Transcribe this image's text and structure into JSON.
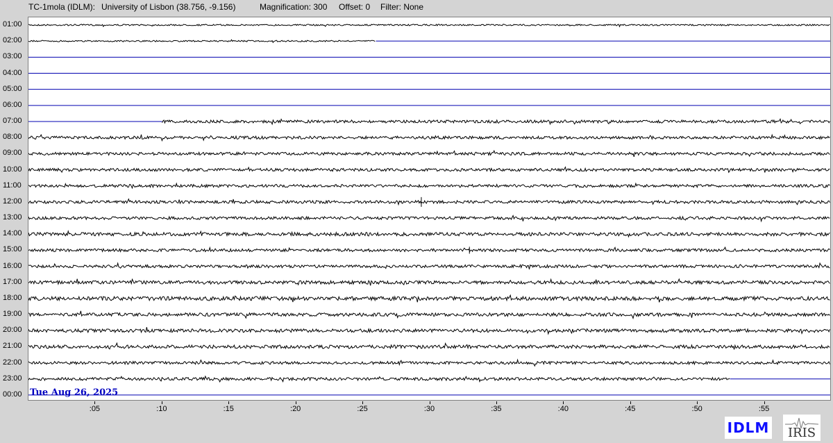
{
  "header": {
    "station": "TC-1mola (IDLM):",
    "location": "University of Lisbon (38.756, -9.156)",
    "magnification": "Magnification: 300",
    "offset": "Offset: 0",
    "filter": "Filter: None"
  },
  "hours": [
    "01:00",
    "02:00",
    "03:00",
    "04:00",
    "05:00",
    "06:00",
    "07:00",
    "08:00",
    "09:00",
    "10:00",
    "11:00",
    "12:00",
    "13:00",
    "14:00",
    "15:00",
    "16:00",
    "17:00",
    "18:00",
    "19:00",
    "20:00",
    "21:00",
    "22:00",
    "23:00",
    "00:00"
  ],
  "minute_ticks": [
    ":05",
    ":10",
    ":15",
    ":20",
    ":25",
    ":30",
    ":35",
    ":40",
    ":45",
    ":50",
    ":55"
  ],
  "date": "Tue Aug 26, 2025",
  "logos": {
    "idlm": "IDLM",
    "iris": "IRIS"
  },
  "colors": {
    "trace": "#000000",
    "baseline": "#0000b0",
    "date": "#0000c0",
    "logo_idlm": "#1010ff"
  },
  "traces": [
    {
      "hour": "01:00",
      "signal_start_min": 0,
      "signal_end_min": 60,
      "amp": 0.3
    },
    {
      "hour": "02:00",
      "signal_start_min": 0,
      "signal_end_min": 26,
      "amp": 0.3
    },
    {
      "hour": "03:00",
      "signal_start_min": null,
      "signal_end_min": null,
      "amp": 0
    },
    {
      "hour": "04:00",
      "signal_start_min": null,
      "signal_end_min": null,
      "amp": 0
    },
    {
      "hour": "05:00",
      "signal_start_min": null,
      "signal_end_min": null,
      "amp": 0
    },
    {
      "hour": "06:00",
      "signal_start_min": null,
      "signal_end_min": null,
      "amp": 0
    },
    {
      "hour": "07:00",
      "signal_start_min": 10,
      "signal_end_min": 60,
      "amp": 0.6
    },
    {
      "hour": "08:00",
      "signal_start_min": 0,
      "signal_end_min": 60,
      "amp": 0.6
    },
    {
      "hour": "09:00",
      "signal_start_min": 0,
      "signal_end_min": 60,
      "amp": 0.6
    },
    {
      "hour": "10:00",
      "signal_start_min": 0,
      "signal_end_min": 60,
      "amp": 0.6
    },
    {
      "hour": "11:00",
      "signal_start_min": 0,
      "signal_end_min": 60,
      "amp": 0.6
    },
    {
      "hour": "12:00",
      "signal_start_min": 0,
      "signal_end_min": 60,
      "amp": 0.6
    },
    {
      "hour": "13:00",
      "signal_start_min": 0,
      "signal_end_min": 60,
      "amp": 0.6
    },
    {
      "hour": "14:00",
      "signal_start_min": 0,
      "signal_end_min": 60,
      "amp": 0.7
    },
    {
      "hour": "15:00",
      "signal_start_min": 0,
      "signal_end_min": 60,
      "amp": 0.6
    },
    {
      "hour": "16:00",
      "signal_start_min": 0,
      "signal_end_min": 60,
      "amp": 0.6
    },
    {
      "hour": "17:00",
      "signal_start_min": 0,
      "signal_end_min": 60,
      "amp": 0.7
    },
    {
      "hour": "18:00",
      "signal_start_min": 0,
      "signal_end_min": 60,
      "amp": 0.8
    },
    {
      "hour": "19:00",
      "signal_start_min": 0,
      "signal_end_min": 60,
      "amp": 0.7
    },
    {
      "hour": "20:00",
      "signal_start_min": 0,
      "signal_end_min": 60,
      "amp": 0.7
    },
    {
      "hour": "21:00",
      "signal_start_min": 0,
      "signal_end_min": 60,
      "amp": 0.7
    },
    {
      "hour": "22:00",
      "signal_start_min": 0,
      "signal_end_min": 60,
      "amp": 0.6
    },
    {
      "hour": "23:00",
      "signal_start_min": 0,
      "signal_end_min": 52.5,
      "amp": 0.6
    },
    {
      "hour": "00:00",
      "signal_start_min": null,
      "signal_end_min": null,
      "amp": 0
    }
  ]
}
